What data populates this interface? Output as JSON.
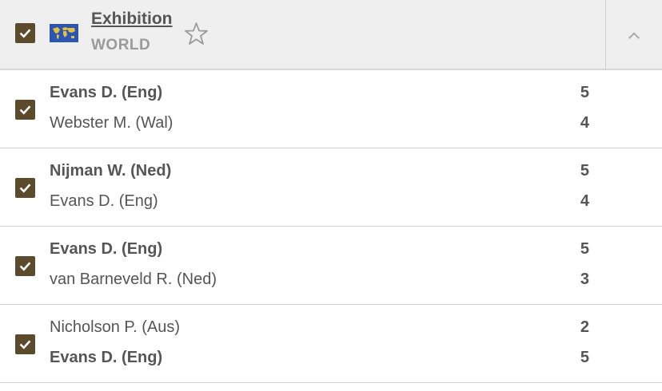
{
  "header": {
    "title": "Exhibition",
    "subtitle": "WORLD",
    "flag_icon": "world-map-flag-icon",
    "favorite_icon": "star-outline-icon",
    "collapse_icon": "chevron-up-icon"
  },
  "colors": {
    "checkbox": "#5c4a2c",
    "header_bg": "#efefef",
    "text": "#555555",
    "muted": "#9a9a9a"
  },
  "matches": [
    {
      "checked": true,
      "player1": {
        "name": "Evans D. (Eng)",
        "score": "5",
        "winner": true
      },
      "player2": {
        "name": "Webster M. (Wal)",
        "score": "4",
        "winner": false
      }
    },
    {
      "checked": true,
      "player1": {
        "name": "Nijman W. (Ned)",
        "score": "5",
        "winner": true
      },
      "player2": {
        "name": "Evans D. (Eng)",
        "score": "4",
        "winner": false
      }
    },
    {
      "checked": true,
      "player1": {
        "name": "Evans D. (Eng)",
        "score": "5",
        "winner": true
      },
      "player2": {
        "name": "van Barneveld R. (Ned)",
        "score": "3",
        "winner": false
      }
    },
    {
      "checked": true,
      "player1": {
        "name": "Nicholson P. (Aus)",
        "score": "2",
        "winner": false
      },
      "player2": {
        "name": "Evans D. (Eng)",
        "score": "5",
        "winner": true
      }
    }
  ]
}
